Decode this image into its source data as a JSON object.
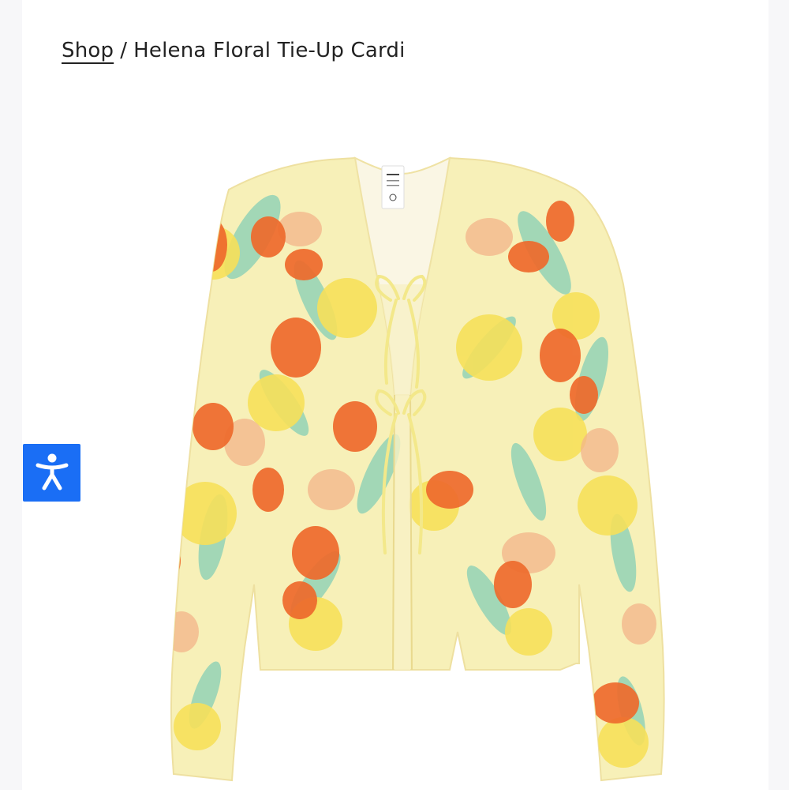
{
  "breadcrumb": {
    "shop_label": "Shop",
    "separator": "/",
    "current": "Helena Floral Tie-Up Cardi"
  },
  "product": {
    "image_alt": "Helena Floral Tie-Up Cardi product photo",
    "garment_colors": {
      "base": "#f7f0b8",
      "orange": "#ee6a2c",
      "yellow": "#f6e05a",
      "mint": "#93d3b6",
      "peach": "#f3b48a"
    },
    "label_tag_text": "monki"
  },
  "accessibility": {
    "icon": "accessibility-icon",
    "button_color": "#1a6ef5"
  }
}
